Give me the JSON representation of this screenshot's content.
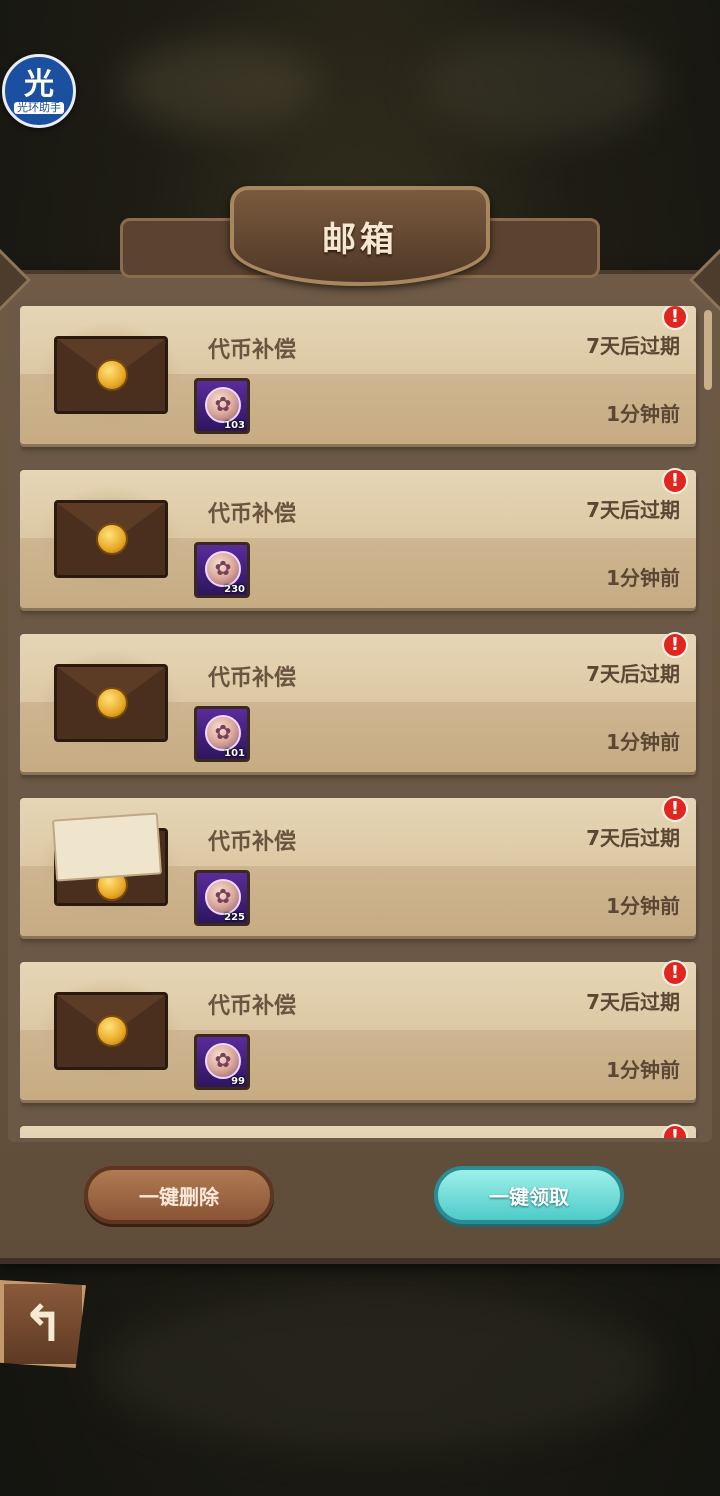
{
  "assistant": {
    "glyph": "光",
    "label": "光环助手"
  },
  "header": {
    "title": "邮箱"
  },
  "mails": [
    {
      "title": "代币补偿",
      "expire": "7天后过期",
      "time": "1分钟前",
      "reward_count": "103",
      "alert": "!",
      "opened": false
    },
    {
      "title": "代币补偿",
      "expire": "7天后过期",
      "time": "1分钟前",
      "reward_count": "230",
      "alert": "!",
      "opened": false
    },
    {
      "title": "代币补偿",
      "expire": "7天后过期",
      "time": "1分钟前",
      "reward_count": "101",
      "alert": "!",
      "opened": false
    },
    {
      "title": "代币补偿",
      "expire": "7天后过期",
      "time": "1分钟前",
      "reward_count": "225",
      "alert": "!",
      "opened": true
    },
    {
      "title": "代币补偿",
      "expire": "7天后过期",
      "time": "1分钟前",
      "reward_count": "99",
      "alert": "!",
      "opened": false
    },
    {
      "alert": "!"
    }
  ],
  "actions": {
    "delete_all": "一键删除",
    "claim_all": "一键领取"
  },
  "nav": {
    "back_glyph": "↰"
  }
}
